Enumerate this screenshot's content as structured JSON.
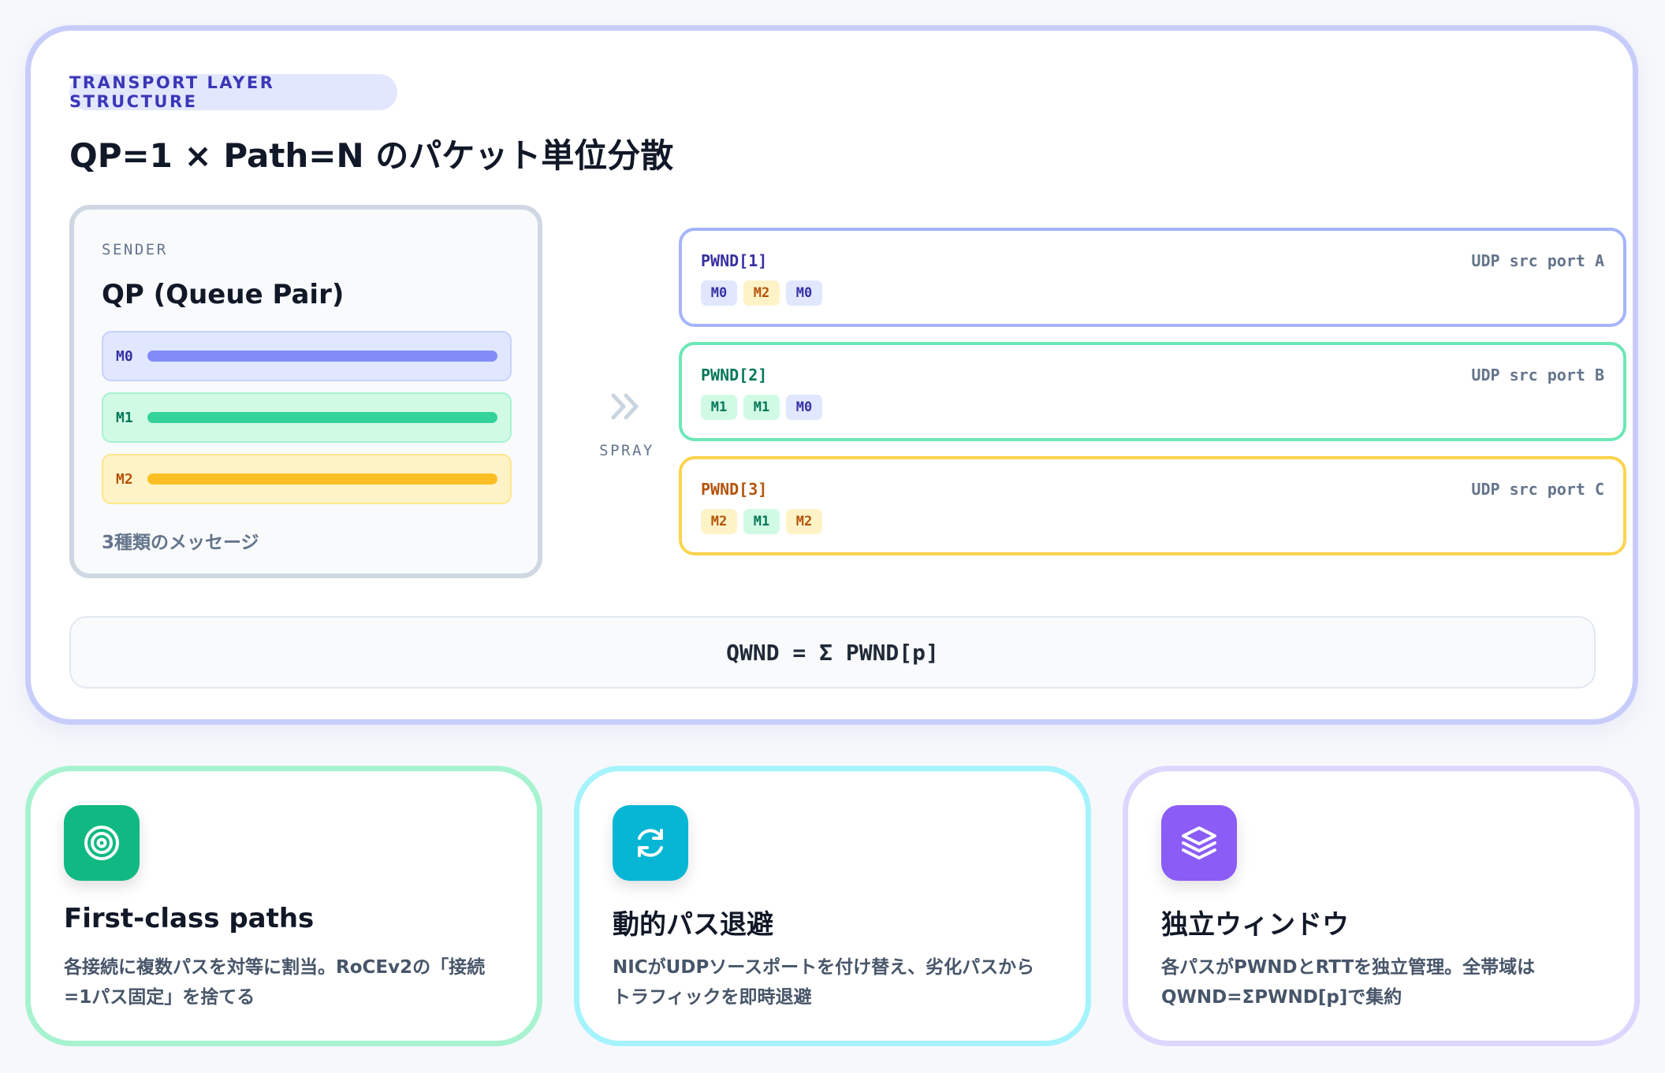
{
  "diagram": {
    "kicker": "TRANSPORT LAYER STRUCTURE",
    "title": "QP=1 × Path=N のパケット単位分散",
    "sender": {
      "label": "SENDER",
      "title": "QP (Queue Pair)",
      "messages": [
        {
          "tag": "M0",
          "color": "#818cf8"
        },
        {
          "tag": "M1",
          "color": "#34d399"
        },
        {
          "tag": "M2",
          "color": "#fbbf24"
        }
      ],
      "note": "3種類のメッセージ"
    },
    "spray_label": "SPRAY",
    "paths": [
      {
        "name": "PWND[1]",
        "port": "UDP src port A",
        "chips": [
          "M0",
          "M2",
          "M0"
        ]
      },
      {
        "name": "PWND[2]",
        "port": "UDP src port B",
        "chips": [
          "M1",
          "M1",
          "M0"
        ]
      },
      {
        "name": "PWND[3]",
        "port": "UDP src port C",
        "chips": [
          "M2",
          "M1",
          "M2"
        ]
      }
    ],
    "formula": "QWND = Σ PWND[p]"
  },
  "features": [
    {
      "icon": "target-icon",
      "title": "First-class paths",
      "desc_line1": "各接続に複数パスを対等に割当。RoCEv2の「接続",
      "desc_line2": "=1パス固定」を捨てる"
    },
    {
      "icon": "refresh-icon",
      "title": "動的パス退避",
      "desc_line1": "NICがUDPソースポートを付け替え、劣化パスから",
      "desc_line2": "トラフィックを即時退避"
    },
    {
      "icon": "layers-icon",
      "title": "独立ウィンドウ",
      "desc_line1": "各パスがPWNDとRTTを独立管理。全帯域は",
      "desc_line2": "QWND=ΣPWND[p]で集約"
    }
  ]
}
